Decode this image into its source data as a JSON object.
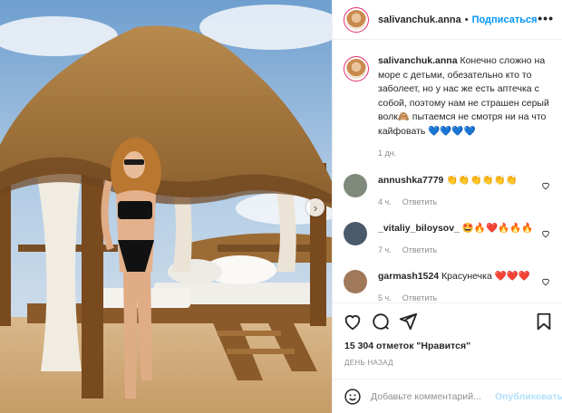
{
  "post": {
    "username": "salivanchuk.anna",
    "follow_label": "Подписаться",
    "dot": "•",
    "more": "•••"
  },
  "caption": {
    "username": "salivanchuk.anna",
    "text": "Конечно сложно на море с детьми, обезательно кто то заболеет, но у нас же есть аптечка с собой, поэтому нам не страшен серый волк🙈 пытаемся не смотря ни на что кайфовать",
    "hearts": "💙💙💙💙",
    "time": "1 дн."
  },
  "comments": [
    {
      "username": "annushka7779",
      "text": "👏👏👏👏👏👏",
      "time": "4 ч.",
      "reply_label": "Ответить",
      "avatar_color": "#7f8a7c"
    },
    {
      "username": "_vitaliy_biloysov_",
      "text": "🤩🔥❤️🔥🔥🔥",
      "time": "7 ч.",
      "reply_label": "Ответить",
      "avatar_color": "#4a5a6a"
    },
    {
      "username": "garmash1524",
      "text": "Красунечка ❤️❤️❤️",
      "time": "5 ч.",
      "reply_label": "Ответить",
      "avatar_color": "#a0785a"
    }
  ],
  "likes": "15 304 отметок \"Нравится\"",
  "when": "ДЕНЬ НАЗАД",
  "add_comment": {
    "placeholder": "Добавьте комментарий...",
    "post_label": "Опубликовать"
  },
  "colors": {
    "accent": "#0095f6",
    "muted": "#8e8e8e",
    "border": "#efefef"
  }
}
